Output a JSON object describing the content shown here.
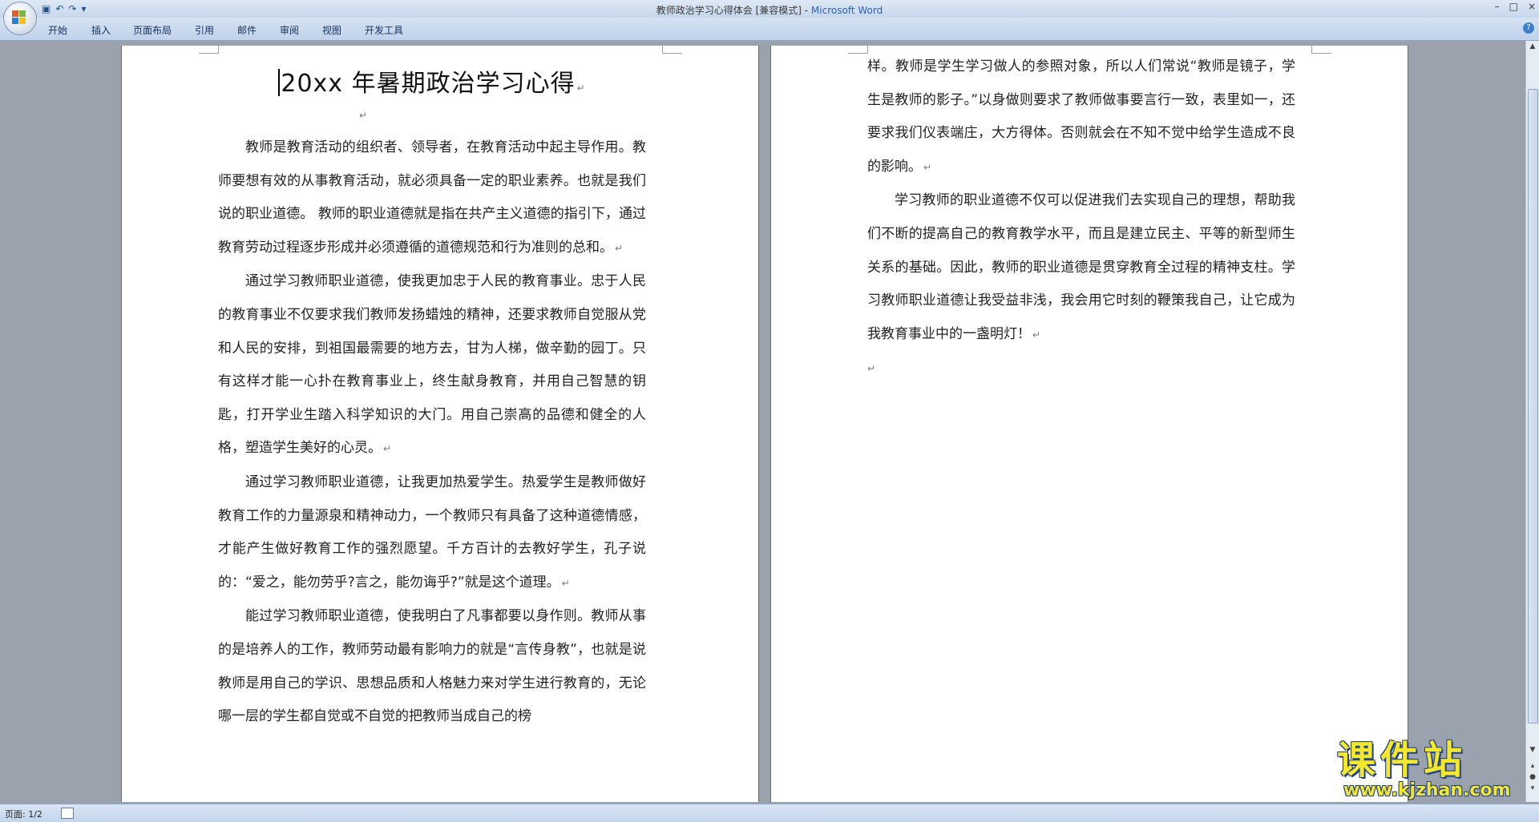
{
  "window": {
    "title": "教师政治学习心得体会 [兼容模式] - ",
    "app_name": "Microsoft Word",
    "controls": [
      "–",
      "□",
      "×"
    ]
  },
  "quick_access": {
    "save": "▣",
    "undo": "↶",
    "redo": "↷",
    "customize": "▾"
  },
  "ribbon": {
    "tabs": [
      "开始",
      "插入",
      "页面布局",
      "引用",
      "邮件",
      "审阅",
      "视图",
      "开发工具"
    ],
    "help": "?"
  },
  "document": {
    "title": "20xx 年暑期政治学习心得",
    "para_mark": "↵",
    "page1_paragraphs": [
      "教师是教育活动的组织者、领导者，在教育活动中起主导作用。教师要想有效的从事教育活动，就必须具备一定的职业素养。也就是我们说的职业道德。 教师的职业道德就是指在共产主义道德的指引下，通过教育劳动过程逐步形成并必须遵循的道德规范和行为准则的总和。",
      "通过学习教师职业道德，使我更加忠于人民的教育事业。忠于人民的教育事业不仅要求我们教师发扬蜡烛的精神，还要求教师自觉服从党和人民的安排，到祖国最需要的地方去，甘为人梯，做辛勤的园丁。只有这样才能一心扑在教育事业上，终生献身教育，并用自己智慧的钥匙，打开学业生踏入科学知识的大门。用自己崇高的品德和健全的人格，塑造学生美好的心灵。",
      "通过学习教师职业道德，让我更加热爱学生。热爱学生是教师做好教育工作的力量源泉和精神动力，一个教师只有具备了这种道德情感，才能产生做好教育工作的强烈愿望。千方百计的去教好学生，孔子说的：“爱之，能勿劳乎?言之，能勿诲乎?”就是这个道理。",
      "能过学习教师职业道德，使我明白了凡事都要以身作则。教师从事的是培养人的工作，教师劳动最有影响力的就是“言传身教”，也就是说教师是用自己的学识、思想品质和人格魅力来对学生进行教育的，无论哪一层的学生都自觉或不自觉的把教师当成自己的榜"
    ],
    "page2_continuation": "样。教师是学生学习做人的参照对象，所以人们常说“教师是镜子，学生是教师的影子。”以身做则要求了教师做事要言行一致，表里如一，还要求我们仪表端庄，大方得体。否则就会在不知不觉中给学生造成不良的影响。",
    "page2_paragraph": "学习教师的职业道德不仅可以促进我们去实现自己的理想，帮助我们不断的提高自己的教育教学水平，而且是建立民主、平等的新型师生关系的基础。因此，教师的职业道德是贯穿教育全过程的精神支柱。学习教师职业道德让我受益非浅，我会用它时刻的鞭策我自己，让它成为我教育事业中的一盏明灯！"
  },
  "status": {
    "page": "页面: 1/2"
  },
  "watermark": {
    "main": "课件站",
    "sub": "www.kjzhan.com"
  }
}
